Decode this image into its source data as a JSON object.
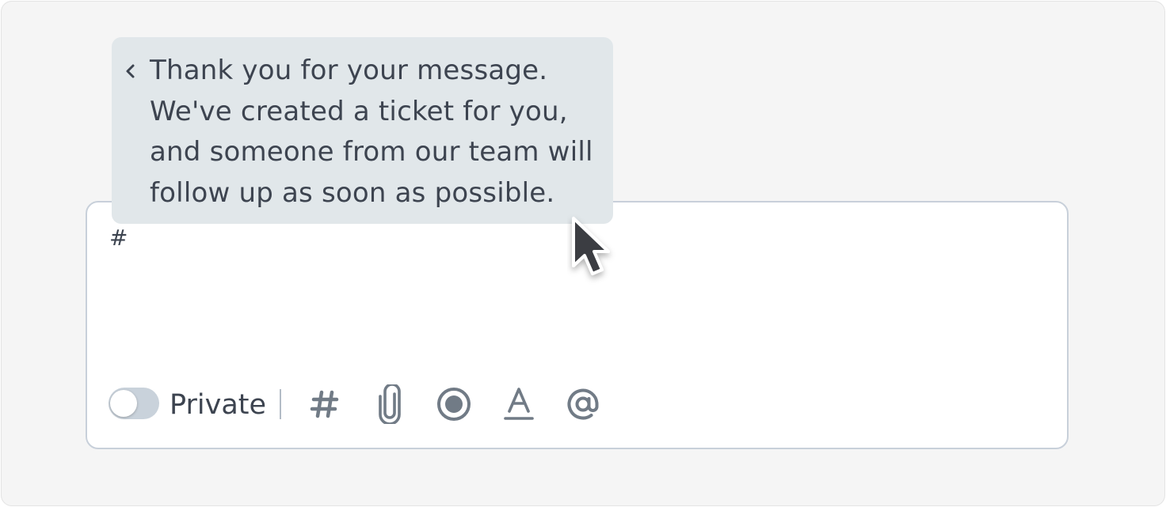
{
  "suggestion": {
    "lines": [
      "Thank you for your message.",
      "We've created a ticket for you,",
      "and someone from our team will",
      "follow up as soon as possible."
    ]
  },
  "composer": {
    "value": "#"
  },
  "toolbar": {
    "private_label": "Private",
    "private_enabled": false,
    "icons": [
      "hashtag-icon",
      "paperclip-icon",
      "record-icon",
      "text-format-icon",
      "at-icon"
    ]
  },
  "colors": {
    "background": "#f5f5f5",
    "suggestion_bg": "#e1e7ea",
    "text": "#3d4450",
    "icon": "#717b86",
    "border": "#c8d0da"
  }
}
